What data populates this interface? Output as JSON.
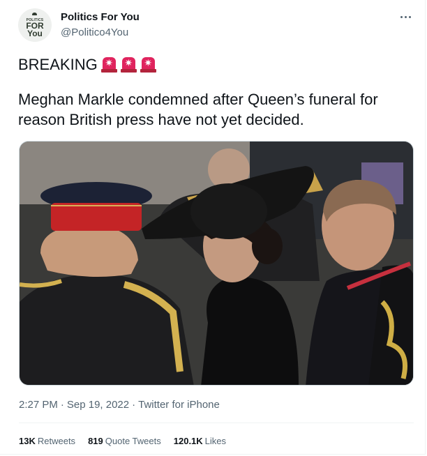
{
  "account": {
    "display_name": "Politics For You",
    "handle": "@Politico4You",
    "avatar_top": "POLITICS",
    "avatar_mid": "FOR",
    "avatar_bottom": "You"
  },
  "tweet": {
    "lead": "BREAKING",
    "emoji": [
      "rotating-light-icon",
      "rotating-light-icon",
      "rotating-light-icon"
    ],
    "body": "Meghan Markle condemned after Queen’s funeral for reason British press have not yet decided."
  },
  "media": {
    "alt": "photo"
  },
  "meta": {
    "time": "2:27 PM",
    "date": "Sep 19, 2022",
    "source": "Twitter for iPhone",
    "separator": "·"
  },
  "stats": {
    "retweets_count": "13K",
    "retweets_label": "Retweets",
    "quotes_count": "819",
    "quotes_label": "Quote Tweets",
    "likes_count": "120.1K",
    "likes_label": "Likes"
  },
  "colors": {
    "text": "#0f1419",
    "secondary": "#536471",
    "siren": "#e0245e"
  }
}
